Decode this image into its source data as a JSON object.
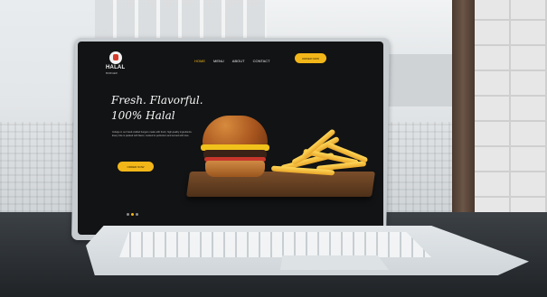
{
  "site": {
    "logo": {
      "name": "HALAL",
      "sub": "BURGER"
    },
    "nav": [
      "HOME",
      "MENU",
      "ABOUT",
      "CONTACT"
    ],
    "cta_top": "ORDER NOW",
    "headline": "Fresh. Flavorful. 100% Halal",
    "paragraph": "Indulge in our hand-crafted burgers made with fresh, high-quality ingredients. Every bite is packed with flavor, cooked to perfection and served with love.",
    "hero_button": "ORDER NOW",
    "slider": {
      "count": 3,
      "active": 1
    },
    "colors": {
      "accent": "#f2b619",
      "background": "#121314",
      "text": "#f7f7f7"
    }
  },
  "scene": {
    "objects": [
      "laptop",
      "burger",
      "fries",
      "wooden-board"
    ],
    "icons": [
      "logo-icon"
    ]
  }
}
